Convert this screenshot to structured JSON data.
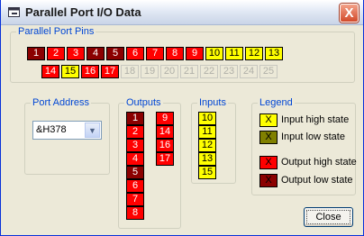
{
  "window": {
    "title": "Parallel Port I/O Data",
    "close_glyph": "X"
  },
  "pins_group": {
    "label": "Parallel Port Pins",
    "row1": [
      {
        "n": "1",
        "state": "off-r"
      },
      {
        "n": "2",
        "state": "on-r"
      },
      {
        "n": "3",
        "state": "on-r"
      },
      {
        "n": "4",
        "state": "off-r"
      },
      {
        "n": "5",
        "state": "off-r"
      },
      {
        "n": "6",
        "state": "on-r"
      },
      {
        "n": "7",
        "state": "on-r"
      },
      {
        "n": "8",
        "state": "on-r"
      },
      {
        "n": "9",
        "state": "on-r"
      },
      {
        "n": "10",
        "state": "on-y"
      },
      {
        "n": "11",
        "state": "on-y"
      },
      {
        "n": "12",
        "state": "on-y"
      },
      {
        "n": "13",
        "state": "on-y"
      }
    ],
    "row2": [
      {
        "n": "14",
        "state": "on-r"
      },
      {
        "n": "15",
        "state": "on-y"
      },
      {
        "n": "16",
        "state": "on-r"
      },
      {
        "n": "17",
        "state": "on-r"
      },
      {
        "n": "18",
        "state": "dis"
      },
      {
        "n": "19",
        "state": "dis"
      },
      {
        "n": "20",
        "state": "dis"
      },
      {
        "n": "21",
        "state": "dis"
      },
      {
        "n": "22",
        "state": "dis"
      },
      {
        "n": "23",
        "state": "dis"
      },
      {
        "n": "24",
        "state": "dis"
      },
      {
        "n": "25",
        "state": "dis"
      }
    ]
  },
  "port": {
    "label": "Port Address",
    "value": "&H378",
    "dropdown_glyph": "▼"
  },
  "outputs": {
    "label": "Outputs",
    "col1": [
      {
        "n": "1",
        "state": "off-r"
      },
      {
        "n": "2",
        "state": "on-r"
      },
      {
        "n": "3",
        "state": "on-r"
      },
      {
        "n": "4",
        "state": "on-r"
      },
      {
        "n": "5",
        "state": "off-r"
      },
      {
        "n": "6",
        "state": "on-r"
      },
      {
        "n": "7",
        "state": "on-r"
      },
      {
        "n": "8",
        "state": "on-r"
      }
    ],
    "col2": [
      {
        "n": "9",
        "state": "on-r"
      },
      {
        "n": "14",
        "state": "on-r"
      },
      {
        "n": "16",
        "state": "on-r"
      },
      {
        "n": "17",
        "state": "on-r"
      }
    ]
  },
  "inputs": {
    "label": "Inputs",
    "col": [
      {
        "n": "10"
      },
      {
        "n": "11"
      },
      {
        "n": "12"
      },
      {
        "n": "13"
      },
      {
        "n": "15"
      }
    ]
  },
  "legend": {
    "label": "Legend",
    "items": [
      {
        "mark": "X",
        "text": "Input high state",
        "state": "on-y"
      },
      {
        "mark": "X",
        "text": "Input low state",
        "state": "inlow"
      },
      {
        "mark": "X",
        "text": "Output high state",
        "state": "on-r"
      },
      {
        "mark": "X",
        "text": "Output low state",
        "state": "off-r"
      }
    ]
  },
  "close_button": {
    "label": "Close"
  }
}
